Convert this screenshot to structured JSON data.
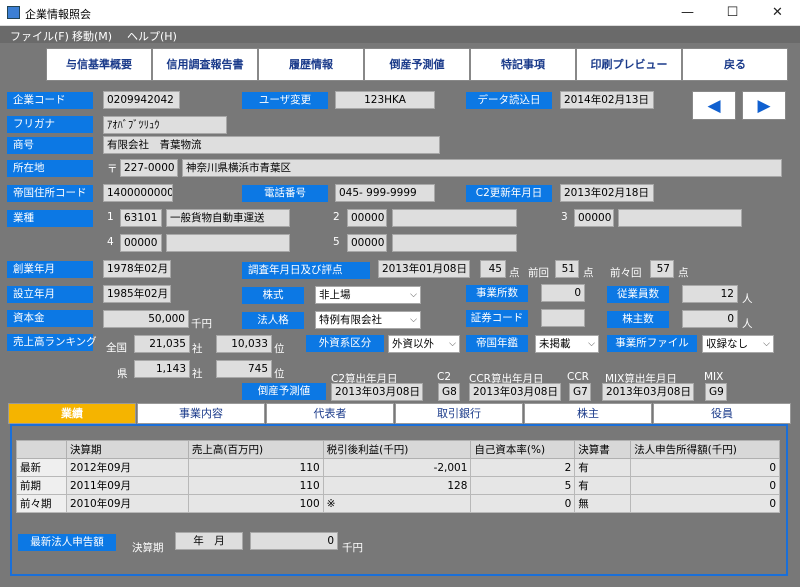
{
  "window": {
    "title": "企業情報照会",
    "min": "—",
    "max": "☐",
    "close": "✕"
  },
  "menu": [
    "ファイル(F)",
    "移動(M)",
    "ヘルプ(H)"
  ],
  "toolbar": [
    "与信基準概要",
    "信用調査報告書",
    "履歴情報",
    "倒産予測値",
    "特記事項",
    "印刷プレビュー",
    "戻る"
  ],
  "nav": {
    "prev": "◀",
    "next": "▶"
  },
  "fields": {
    "company_code_label": "企業コード",
    "company_code": "0209942042",
    "user_change_label": "ユーザ変更",
    "user_change": "123HKA",
    "data_read_label": "データ読込日",
    "data_read": "2014年02月13日",
    "furigana_label": "フリガナ",
    "furigana": "ｱｵﾊﾞﾌﾞﾂﾘｭｳ",
    "name_label": "商号",
    "name": "有限会社　青葉物流",
    "address_label": "所在地",
    "postal_mark": "〒",
    "postal": "227-0000",
    "address": "神奈川県横浜市青葉区",
    "teikoku_addr_label": "帝国住所コード",
    "teikoku_addr": "1400000000",
    "phone_label": "電話番号",
    "phone": "045- 999-9999",
    "c2_update_label": "C2更新年月日",
    "c2_update": "2013年02月18日",
    "industry_label": "業種",
    "ind1_no": "1",
    "ind1_code": "63101",
    "ind1_name": "一般貨物自動車運送",
    "ind2_no": "2",
    "ind2_code": "00000",
    "ind2_name": "",
    "ind3_no": "3",
    "ind3_code": "00000",
    "ind3_name": "",
    "ind4_no": "4",
    "ind4_code": "00000",
    "ind4_name": "",
    "ind5_no": "5",
    "ind5_code": "00000",
    "ind5_name": "",
    "founded_label": "創業年月",
    "founded": "1978年02月",
    "survey_label": "調査年月日及び評点",
    "survey_date": "2013年01月08日",
    "score": "45",
    "score_unit": "点",
    "prev_label": "前回",
    "prev_score": "51",
    "prev_unit": "点",
    "prev2_label": "前々回",
    "prev2_score": "57",
    "prev2_unit": "点",
    "established_label": "設立年月",
    "established": "1985年02月",
    "stock_label": "株式",
    "stock": "非上場",
    "offices_label": "事業所数",
    "offices": "0",
    "employees_label": "従業員数",
    "employees": "12",
    "employees_unit": "人",
    "capital_label": "資本金",
    "capital": "50,000",
    "capital_unit": "千円",
    "corp_type_label": "法人格",
    "corp_type": "特例有限会社",
    "securities_label": "証券コード",
    "securities": "",
    "shareholders_label": "株主数",
    "shareholders": "0",
    "shareholders_unit": "人",
    "sales_rank_label": "売上高ランキング",
    "national_label": "全国",
    "national_rank": "21,035",
    "national_unit": "社",
    "national_pos": "10,033",
    "national_pos_unit": "位",
    "pref_label": "県",
    "pref_rank": "1,143",
    "pref_unit": "社",
    "pref_pos": "745",
    "pref_pos_unit": "位",
    "foreign_label": "外資系区分",
    "foreign": "外資以外",
    "teikoku_year_label": "帝国年鑑",
    "teikoku_year": "未掲載",
    "office_file_label": "事業所ファイル",
    "office_file": "収録なし",
    "bankrupt_label": "倒産予測値",
    "c2_calc_label": "C2算出年月日",
    "c2_calc": "2013年03月08日",
    "c2_label": "C2",
    "c2": "G8",
    "ccr_calc_label": "CCR算出年月日",
    "ccr_calc": "2013年03月08日",
    "ccr_label": "CCR",
    "ccr": "G7",
    "mix_calc_label": "MIX算出年月日",
    "mix_calc": "2013年03月08日",
    "mix_label": "MIX",
    "mix": "G9"
  },
  "tabs": [
    "業績",
    "事業内容",
    "代表者",
    "取引銀行",
    "株主",
    "役員"
  ],
  "table": {
    "headers": [
      "",
      "決算期",
      "売上高(百万円)",
      "税引後利益(千円)",
      "自己資本率(%)",
      "決算書",
      "法人申告所得額(千円)"
    ],
    "rows": [
      [
        "最新",
        "2012年09月",
        "110",
        "-2,001",
        "2",
        "有",
        "0"
      ],
      [
        "前期",
        "2011年09月",
        "110",
        "128",
        "5",
        "有",
        "0"
      ],
      [
        "前々期",
        "2010年09月",
        "100",
        "※",
        "0",
        "無",
        "0"
      ]
    ]
  },
  "tax": {
    "label": "最新法人申告額",
    "period_label": "決算期",
    "period": "年　月",
    "amount": "0",
    "unit": "千円"
  }
}
